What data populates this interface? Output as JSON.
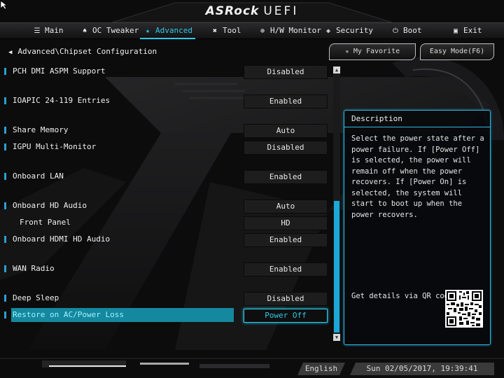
{
  "header": {
    "brand": "ASRock",
    "product": "UEFI"
  },
  "menu": [
    {
      "label": "Main",
      "icon": "list-icon",
      "active": false
    },
    {
      "label": "OC Tweaker",
      "icon": "flame-icon",
      "active": false
    },
    {
      "label": "Advanced",
      "icon": "star-icon",
      "active": true
    },
    {
      "label": "Tool",
      "icon": "tools-icon",
      "active": false
    },
    {
      "label": "H/W Monitor",
      "icon": "monitor-icon",
      "active": false
    },
    {
      "label": "Security",
      "icon": "shield-icon",
      "active": false
    },
    {
      "label": "Boot",
      "icon": "power-icon",
      "active": false
    },
    {
      "label": "Exit",
      "icon": "exit-icon",
      "active": false
    }
  ],
  "breadcrumb": "Advanced\\Chipset Configuration",
  "buttons": {
    "favorite": "My Favorite",
    "easy_mode": "Easy Mode(F6)"
  },
  "settings": [
    {
      "label": "PCH DMI ASPM Support",
      "value": "Disabled"
    },
    {
      "label": "IOAPIC 24-119 Entries",
      "value": "Enabled"
    },
    {
      "label": "Share Memory",
      "value": "Auto"
    },
    {
      "label": "IGPU Multi-Monitor",
      "value": "Disabled"
    },
    {
      "label": "Onboard LAN",
      "value": "Enabled"
    },
    {
      "label": "Onboard HD Audio",
      "value": "Auto"
    },
    {
      "label": "Front Panel",
      "value": "HD"
    },
    {
      "label": "Onboard HDMI HD Audio",
      "value": "Enabled"
    },
    {
      "label": "WAN Radio",
      "value": "Enabled"
    },
    {
      "label": "Deep Sleep",
      "value": "Disabled"
    },
    {
      "label": "Restore on AC/Power Loss",
      "value": "Power Off"
    }
  ],
  "selected_setting": "Restore on AC/Power Loss",
  "description": {
    "title": "Description",
    "text": "Select the power state after a power failure. If [Power Off] is selected, the power will remain off when the power recovers. If [Power On] is selected, the system will start to boot up when the power recovers.",
    "qr_label": "Get details via QR code"
  },
  "footer": {
    "language": "English",
    "datetime": "Sun 02/05/2017, 19:39:41"
  },
  "colors": {
    "accent": "#2ec8e8",
    "highlight_row": "#14889e"
  }
}
